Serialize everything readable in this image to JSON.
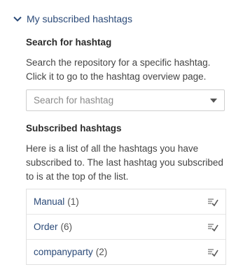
{
  "section": {
    "title": "My subscribed hashtags",
    "collapse_icon": "chevron-down-icon"
  },
  "search": {
    "heading": "Search for hashtag",
    "description_line1": "Search the repository for a specific hashtag.",
    "description_line2": "Click it to go to the hashtag overview page.",
    "placeholder": "Search for hashtag"
  },
  "subscribed": {
    "heading": "Subscribed hashtags",
    "description_line1": "Here is a list of all the hashtags you have",
    "description_line2": "subscribed to. The last hashtag you subscribed",
    "description_line3": "to is at the top of the list.",
    "items": [
      {
        "name": "Manual",
        "count": "(1)",
        "icon": "unsubscribe-icon"
      },
      {
        "name": "Order",
        "count": "(6)",
        "icon": "unsubscribe-icon"
      },
      {
        "name": "companyparty",
        "count": "(2)",
        "icon": "unsubscribe-icon"
      }
    ]
  },
  "colors": {
    "link": "#2b4a78",
    "text": "#444444",
    "border": "#cfcfcf"
  }
}
